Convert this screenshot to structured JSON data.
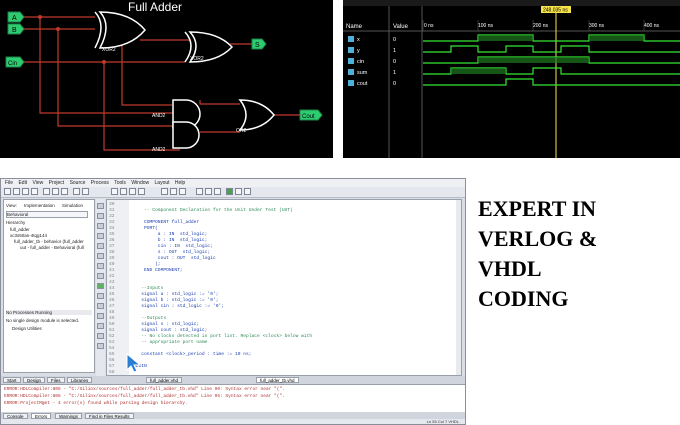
{
  "circuit": {
    "title": "Full Adder",
    "inputs": [
      "A",
      "B",
      "Cin"
    ],
    "gates": [
      "XOR2",
      "XOR2",
      "AND2",
      "AND2",
      "OR2"
    ],
    "outputs": [
      "S",
      "Cout"
    ]
  },
  "waveform": {
    "col_name": "Name",
    "col_value": "Value",
    "cursor_time": "248.035 ns",
    "ticks": [
      "0 ns",
      "100 ns",
      "200 ns",
      "300 ns",
      "400 ns"
    ],
    "signals": [
      {
        "name": "x",
        "value": "0"
      },
      {
        "name": "y",
        "value": "1"
      },
      {
        "name": "cin",
        "value": "0"
      },
      {
        "name": "sum",
        "value": "1"
      },
      {
        "name": "cout",
        "value": "0"
      }
    ]
  },
  "ide": {
    "menu": [
      "File",
      "Edit",
      "View",
      "Project",
      "Source",
      "Process",
      "Tools",
      "Window",
      "Layout",
      "Help"
    ],
    "left_pane": {
      "view_label": "View:",
      "opt_impl": "Implementation",
      "opt_sim": "Simulation",
      "behavior": "Behavioral",
      "hierarchy": "Hierarchy",
      "items": [
        "full_adder",
        "xc3s50an-4tqg144",
        "full_adder_tb - behavior (full_adder",
        "uut - full_adder - Behavioral (full"
      ],
      "processes": "No Processes Running",
      "no_design": "No single design module is selected.",
      "design_utilities": "Design Utilities"
    },
    "code_lines": [
      {
        "n": "30",
        "t": ""
      },
      {
        "n": "31",
        "t": "    -- Component Declaration for the Unit Under Test (UUT)"
      },
      {
        "n": "32",
        "t": ""
      },
      {
        "n": "33",
        "t": "    COMPONENT full_adder"
      },
      {
        "n": "34",
        "t": "    PORT("
      },
      {
        "n": "35",
        "t": "         a : IN  std_logic;"
      },
      {
        "n": "36",
        "t": "         b : IN  std_logic;"
      },
      {
        "n": "37",
        "t": "         cin : IN  std_logic;"
      },
      {
        "n": "38",
        "t": "         s : OUT  std_logic;"
      },
      {
        "n": "39",
        "t": "         cout : OUT  std_logic"
      },
      {
        "n": "40",
        "t": "        );"
      },
      {
        "n": "41",
        "t": "    END COMPONENT;"
      },
      {
        "n": "42",
        "t": ""
      },
      {
        "n": "43",
        "t": ""
      },
      {
        "n": "44",
        "t": "   --Inputs"
      },
      {
        "n": "45",
        "t": "   signal a : std_logic := '0';"
      },
      {
        "n": "46",
        "t": "   signal b : std_logic := '0';"
      },
      {
        "n": "47",
        "t": "   signal cin : std_logic := '0';"
      },
      {
        "n": "48",
        "t": ""
      },
      {
        "n": "49",
        "t": "   --Outputs"
      },
      {
        "n": "50",
        "t": "   signal s : std_logic;"
      },
      {
        "n": "51",
        "t": "   signal cout : std_logic;"
      },
      {
        "n": "52",
        "t": "   -- No clocks detected in port list. Replace <clock> below with"
      },
      {
        "n": "53",
        "t": "   -- appropriate port name"
      },
      {
        "n": "54",
        "t": ""
      },
      {
        "n": "55",
        "t": "   constant <clock>_period : time := 10 ns;"
      },
      {
        "n": "56",
        "t": ""
      },
      {
        "n": "57",
        "t": "BEGIN"
      },
      {
        "n": "58",
        "t": ""
      }
    ],
    "tabs": [
      "Start",
      "Design",
      "Files",
      "Libraries",
      "full_adder.vhd",
      "full_adder_tb.vhd"
    ],
    "console": [
      "ERROR:HDLCompiler:806 - \"C:/Xilinx/sources/full_adder/full_adder_tb.vhd\" Line 90: Syntax error near \"(\".",
      "ERROR:HDLCompiler:806 - \"C:/Xilinx/sources/full_adder/full_adder_tb.vhd\" Line 95: Syntax error near \"(\".",
      "ERROR:ProjectMgmt - 4 error(s) found while parsing design hierarchy."
    ],
    "bottom_tabs": [
      "Console",
      "Errors",
      "Warnings",
      "Find in Files Results"
    ],
    "status": "Ln 55 Col 7   VHDL"
  },
  "headline": [
    "EXPERT IN",
    "VERLOG &",
    "VHDL",
    "CODING"
  ]
}
